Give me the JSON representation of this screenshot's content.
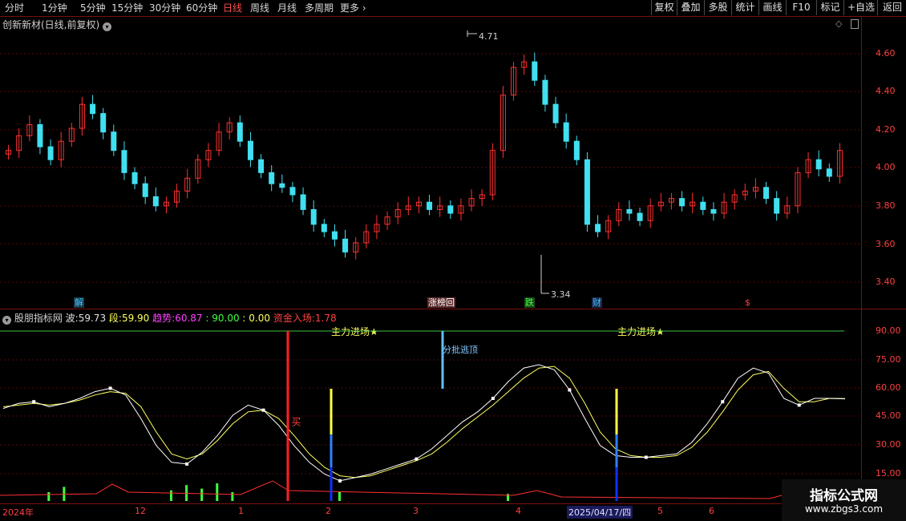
{
  "toolbar": {
    "periods": [
      "分时",
      "1分钟",
      "5分钟",
      "15分钟",
      "30分钟",
      "60分钟",
      "日线",
      "周线",
      "月线",
      "多周期",
      "更多"
    ],
    "active_period": "日线",
    "right_buttons": [
      "复权",
      "叠加",
      "多股",
      "统计",
      "画线",
      "F10",
      "标记",
      "+自选",
      "返回"
    ]
  },
  "price_panel": {
    "title": "创新新材(日线,前复权)",
    "high_label": "4.71",
    "low_label": "3.34",
    "axis": [
      "4.60",
      "4.40",
      "4.20",
      "4.00",
      "3.80",
      "3.60",
      "3.40"
    ],
    "events": [
      {
        "text": "解",
        "color": "#40c0ff"
      },
      {
        "text": "涨榜回",
        "color": "#ffffff"
      },
      {
        "text": "跌",
        "color": "#40ff40"
      },
      {
        "text": "财",
        "color": "#40c0ff"
      },
      {
        "text": "$",
        "color": "#ff4040"
      }
    ]
  },
  "indicator_panel": {
    "name": "股朋指标网",
    "wave_label": "波:",
    "wave_value": "59.73",
    "seg_label": "段:",
    "seg_value": "59.90",
    "trend_label": "趋势:",
    "trend_value": "60.87",
    "level_90": ": 90.00",
    "level_0": ": 0.00",
    "fund_label": "资金入场:",
    "fund_value": "1.78",
    "annotations": {
      "main_force_1": "主力进场★",
      "main_force_2": "主力进场★",
      "buy": "买",
      "sell": "分批逃顶"
    },
    "axis": [
      "90.00",
      "75.00",
      "60.00",
      "45.00",
      "30.00",
      "15.00"
    ]
  },
  "date_axis": [
    "2024年",
    "12",
    "1",
    "2",
    "3",
    "4",
    "2025/04/17/四",
    "5",
    "6"
  ],
  "watermark": {
    "title": "指标公式网",
    "url": "www.zbgs3.com"
  },
  "colors": {
    "up": "#ff3030",
    "down": "#40e0f0",
    "accent": "#ff4040",
    "grid": "#7a1010"
  },
  "chart_data": {
    "type": "line",
    "title": "",
    "price_ylim": [
      3.3,
      4.75
    ],
    "indicator_ylim": [
      0,
      100
    ],
    "wave": [
      54,
      57,
      58,
      55,
      57,
      60,
      64,
      66,
      62,
      48,
      32,
      22,
      21,
      28,
      38,
      50,
      56,
      53,
      44,
      32,
      22,
      15,
      11,
      13,
      15,
      18,
      21,
      24,
      30,
      38,
      46,
      52,
      60,
      70,
      78,
      80,
      77,
      65,
      48,
      32,
      26,
      25,
      25,
      26,
      27,
      34,
      45,
      58,
      72,
      78,
      75,
      60,
      56,
      60,
      60,
      59.73
    ],
    "segment": [
      55,
      56,
      57,
      56,
      57,
      59,
      62,
      64,
      63,
      55,
      40,
      27,
      24,
      27,
      35,
      45,
      52,
      53,
      48,
      38,
      27,
      19,
      14,
      13,
      14,
      17,
      20,
      23,
      27,
      34,
      42,
      49,
      56,
      64,
      72,
      78,
      79,
      72,
      57,
      40,
      30,
      26,
      25,
      25,
      26,
      31,
      40,
      52,
      65,
      74,
      76,
      66,
      58,
      58,
      60,
      59.9
    ],
    "fund": [
      0,
      0,
      0,
      5,
      8,
      0,
      0,
      0,
      0,
      0,
      0,
      6,
      9,
      7,
      10,
      5,
      0,
      0,
      0,
      0,
      0,
      0,
      5,
      0,
      0,
      0,
      0,
      0,
      0,
      0,
      0,
      0,
      0,
      4,
      0,
      0,
      0,
      0,
      0,
      0,
      0,
      0,
      0,
      0,
      0,
      0,
      0,
      0,
      0,
      0,
      0,
      0,
      0,
      0,
      0,
      1.78
    ]
  }
}
